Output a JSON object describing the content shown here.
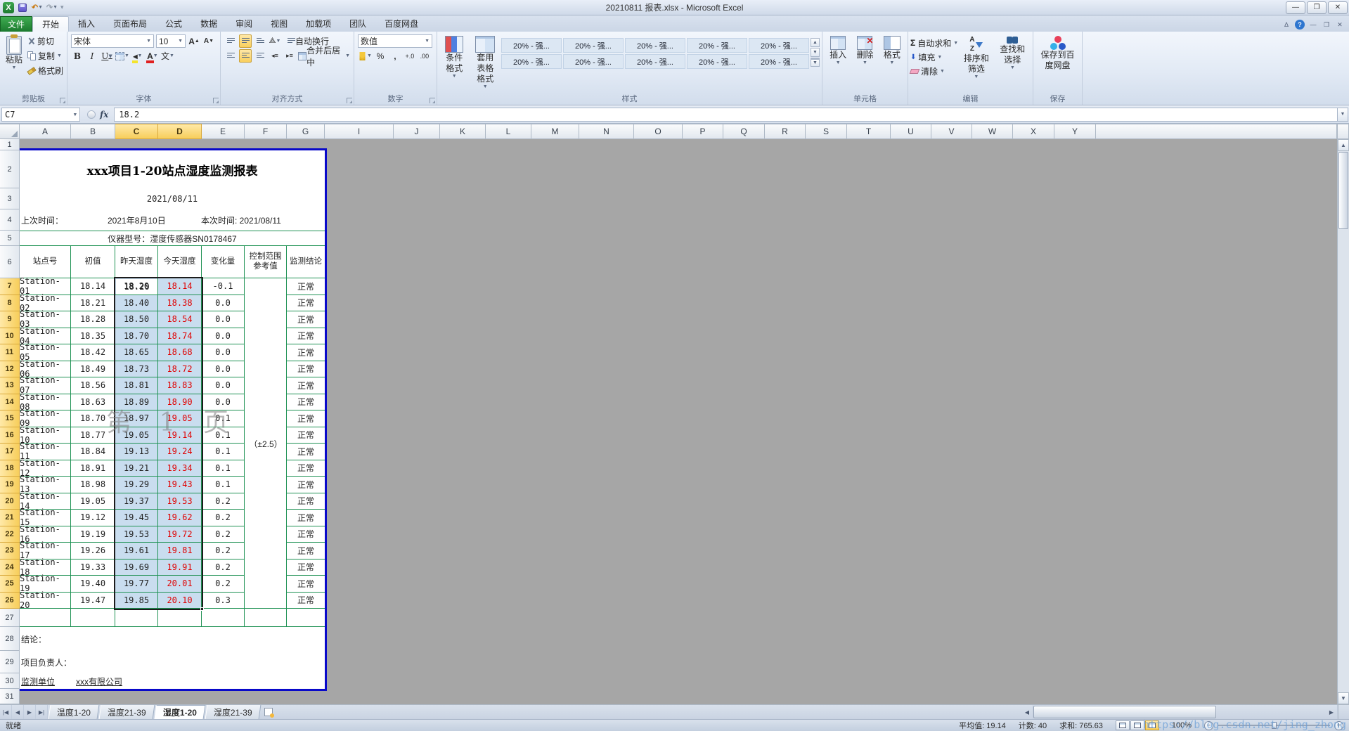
{
  "window": {
    "title": "20210811 报表.xlsx - Microsoft Excel"
  },
  "ribbon": {
    "tabs": [
      {
        "label": "文件",
        "active": false,
        "file": true
      },
      {
        "label": "开始",
        "active": true
      },
      {
        "label": "插入",
        "active": false
      },
      {
        "label": "页面布局",
        "active": false
      },
      {
        "label": "公式",
        "active": false
      },
      {
        "label": "数据",
        "active": false
      },
      {
        "label": "审阅",
        "active": false
      },
      {
        "label": "视图",
        "active": false
      },
      {
        "label": "加载项",
        "active": false
      },
      {
        "label": "团队",
        "active": false
      },
      {
        "label": "百度网盘",
        "active": false
      }
    ],
    "clipboard": {
      "group": "剪贴板",
      "paste": "粘贴",
      "cut": "剪切",
      "copy": "复制",
      "painter": "格式刷"
    },
    "font": {
      "group": "字体",
      "family": "宋体",
      "size": "10",
      "bold": "B",
      "italic": "I",
      "underline": "U",
      "pinyin": "文"
    },
    "alignment": {
      "group": "对齐方式",
      "wrap": "自动换行",
      "merge": "合并后居中"
    },
    "number": {
      "group": "数字",
      "format": "数值",
      "percent": "%",
      "comma": ",",
      "dec_add": "+.0",
      "dec_del": ".00"
    },
    "styles": {
      "group": "样式",
      "conditional": "条件格式",
      "table_format": "套用 表格格式",
      "gallery": [
        "20% - 强...",
        "20% - 强...",
        "20% - 强...",
        "20% - 强...",
        "20% - 强...",
        "20% - 强...",
        "20% - 强...",
        "20% - 强...",
        "20% - 强...",
        "20% - 强..."
      ]
    },
    "cells": {
      "group": "单元格",
      "insert": "插入",
      "delete": "删除",
      "format": "格式"
    },
    "editing": {
      "group": "编辑",
      "autosum": "自动求和",
      "fill": "填充",
      "clear": "清除",
      "sort": "排序和筛选",
      "find": "查找和选择"
    },
    "save": {
      "group": "保存",
      "baidu": "保存到百 度网盘"
    },
    "icons": {
      "dropdown": "▼",
      "sum": "Σ",
      "up": "▲",
      "down": "▼",
      "left": "◀",
      "right": "▶"
    }
  },
  "formula_bar": {
    "name_box": "C7",
    "fx": "fx",
    "content": "18.2"
  },
  "grid": {
    "columns": [
      "A",
      "B",
      "C",
      "D",
      "E",
      "F",
      "G",
      "I",
      "J",
      "K",
      "L",
      "M",
      "N",
      "O",
      "P",
      "Q",
      "R",
      "S",
      "T",
      "U",
      "V",
      "W",
      "X",
      "Y"
    ],
    "selected_columns": [
      "C",
      "D"
    ],
    "rows": [
      "1",
      "2",
      "3",
      "4",
      "5",
      "6",
      "7",
      "8",
      "9",
      "10",
      "11",
      "12",
      "13",
      "14",
      "15",
      "16",
      "17",
      "18",
      "19",
      "20",
      "21",
      "22",
      "23",
      "24",
      "25",
      "26",
      "27",
      "28",
      "29",
      "30",
      "31"
    ],
    "selected_row_start": 7,
    "selected_row_end": 26
  },
  "report": {
    "title": "xxx项目1-20站点湿度监测报表",
    "date": "2021/08/11",
    "last_time_label": "上次时间：",
    "last_time_value": "2021年8月10日",
    "this_time": "本次时间: 2021/08/11",
    "device": "仪器型号：湿度传感器SN0178467",
    "headers": [
      "站点号",
      "初值",
      "昨天湿度",
      "今天湿度",
      "变化量",
      "控制范围参考值",
      "监测结论"
    ],
    "control_range": "（±2.5）",
    "page_watermark": "第 1 页",
    "rows": [
      {
        "station": "Station-01",
        "initial": "18.14",
        "yesterday": "18.20",
        "today": "18.14",
        "change": "-0.1",
        "result": "正常"
      },
      {
        "station": "Station-02",
        "initial": "18.21",
        "yesterday": "18.40",
        "today": "18.38",
        "change": "0.0",
        "result": "正常"
      },
      {
        "station": "Station-03",
        "initial": "18.28",
        "yesterday": "18.50",
        "today": "18.54",
        "change": "0.0",
        "result": "正常"
      },
      {
        "station": "Station-04",
        "initial": "18.35",
        "yesterday": "18.70",
        "today": "18.74",
        "change": "0.0",
        "result": "正常"
      },
      {
        "station": "Station-05",
        "initial": "18.42",
        "yesterday": "18.65",
        "today": "18.68",
        "change": "0.0",
        "result": "正常"
      },
      {
        "station": "Station-06",
        "initial": "18.49",
        "yesterday": "18.73",
        "today": "18.72",
        "change": "0.0",
        "result": "正常"
      },
      {
        "station": "Station-07",
        "initial": "18.56",
        "yesterday": "18.81",
        "today": "18.83",
        "change": "0.0",
        "result": "正常"
      },
      {
        "station": "Station-08",
        "initial": "18.63",
        "yesterday": "18.89",
        "today": "18.90",
        "change": "0.0",
        "result": "正常"
      },
      {
        "station": "Station-09",
        "initial": "18.70",
        "yesterday": "18.97",
        "today": "19.05",
        "change": "0.1",
        "result": "正常"
      },
      {
        "station": "Station-10",
        "initial": "18.77",
        "yesterday": "19.05",
        "today": "19.14",
        "change": "0.1",
        "result": "正常"
      },
      {
        "station": "Station-11",
        "initial": "18.84",
        "yesterday": "19.13",
        "today": "19.24",
        "change": "0.1",
        "result": "正常"
      },
      {
        "station": "Station-12",
        "initial": "18.91",
        "yesterday": "19.21",
        "today": "19.34",
        "change": "0.1",
        "result": "正常"
      },
      {
        "station": "Station-13",
        "initial": "18.98",
        "yesterday": "19.29",
        "today": "19.43",
        "change": "0.1",
        "result": "正常"
      },
      {
        "station": "Station-14",
        "initial": "19.05",
        "yesterday": "19.37",
        "today": "19.53",
        "change": "0.2",
        "result": "正常"
      },
      {
        "station": "Station-15",
        "initial": "19.12",
        "yesterday": "19.45",
        "today": "19.62",
        "change": "0.2",
        "result": "正常"
      },
      {
        "station": "Station-16",
        "initial": "19.19",
        "yesterday": "19.53",
        "today": "19.72",
        "change": "0.2",
        "result": "正常"
      },
      {
        "station": "Station-17",
        "initial": "19.26",
        "yesterday": "19.61",
        "today": "19.81",
        "change": "0.2",
        "result": "正常"
      },
      {
        "station": "Station-18",
        "initial": "19.33",
        "yesterday": "19.69",
        "today": "19.91",
        "change": "0.2",
        "result": "正常"
      },
      {
        "station": "Station-19",
        "initial": "19.40",
        "yesterday": "19.77",
        "today": "20.01",
        "change": "0.2",
        "result": "正常"
      },
      {
        "station": "Station-20",
        "initial": "19.47",
        "yesterday": "19.85",
        "today": "20.10",
        "change": "0.3",
        "result": "正常"
      }
    ],
    "active_cell_display": "18.20",
    "conclusion_label": "结论：",
    "manager_label": "项目负责人：",
    "unit_label": "监测单位",
    "unit_value": "xxx有限公司"
  },
  "sheet_tabs": {
    "tabs": [
      {
        "label": "温度1-20",
        "active": false
      },
      {
        "label": "温度21-39",
        "active": false
      },
      {
        "label": "湿度1-20",
        "active": true
      },
      {
        "label": "湿度21-39",
        "active": false
      }
    ]
  },
  "status_bar": {
    "ready": "就绪",
    "average": "平均值: 19.14",
    "count": "计数: 40",
    "sum": "求和: 765.63",
    "zoom": "100%"
  },
  "overlay_watermark": "https://blog.csdn.net/jing_zhong",
  "colors": {
    "table_border_green": "#1F9254",
    "print_area_blue": "#0909C9",
    "selection_blue": "rgba(120,170,215,0.40)",
    "today_red": "#E00000",
    "header_selected_amber": "#F7CE5B"
  }
}
